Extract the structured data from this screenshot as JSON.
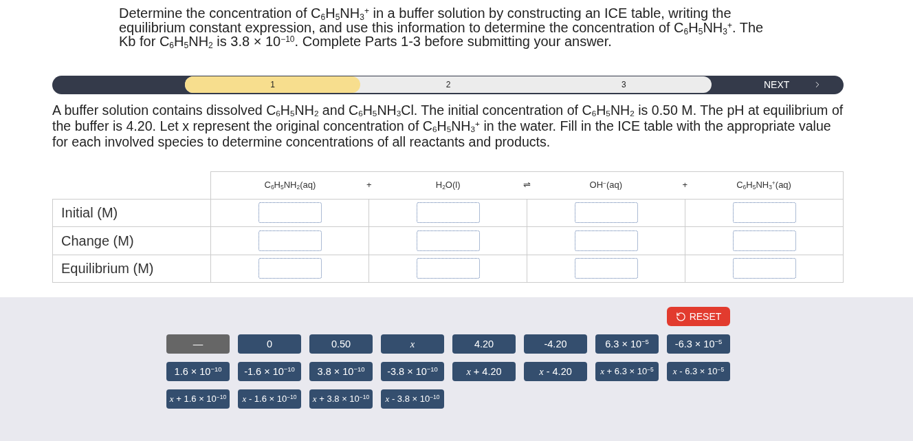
{
  "question": "Determine the concentration of C$_{6}$H$_{5}$NH$_{3}$$^{+}$ in a buffer solution by constructing an ICE table, writing the equilibrium constant expression, and use this information to determine the concentration of C$_{6}$H$_{5}$NH$_{3}$$^{+}$. The Kb for C$_{6}$H$_{5}$NH$_{2}$ is 3.8 × 10$^{−10}$. Complete Parts 1-3 before submitting your answer.",
  "progress": {
    "steps": [
      {
        "label": "1",
        "selected": true
      },
      {
        "label": "2",
        "selected": false
      },
      {
        "label": "3",
        "selected": false
      }
    ],
    "next_label": "NEXT"
  },
  "instructions": "A buffer solution contains dissolved C$_{6}$H$_{5}$NH$_{2}$ and C$_{6}$H$_{5}$NH$_{3}$Cl. The initial concentration of C$_{6}$H$_{5}$NH$_{2}$ is 0.50 M. The pH at equilibrium of the buffer is 4.20. Let x represent the original concentration of C$_{6}$H$_{5}$NH$_{3}$$^{+}$ in the water. Fill in the ICE table with the appropriate value for each involved species to determine concentrations of all reactants and products.",
  "ice_table": {
    "equation": [
      {
        "kind": "species",
        "text": "C$_{6}$H$_{5}$NH$_{2}$(aq)"
      },
      {
        "kind": "operator",
        "text": "+"
      },
      {
        "kind": "species",
        "text": "H$_{2}$O(l)"
      },
      {
        "kind": "operator",
        "text": "⇌"
      },
      {
        "kind": "species",
        "text": "OH$^{−}$(aq)"
      },
      {
        "kind": "operator",
        "text": "+"
      },
      {
        "kind": "species",
        "text": "C$_{6}$H$_{5}$NH$_{3}$$^{+}$(aq)"
      }
    ],
    "rows": [
      {
        "label": "Initial (M)"
      },
      {
        "label": "Change (M)"
      },
      {
        "label": "Equilibrium (M)"
      }
    ]
  },
  "answer_tray": {
    "reset_label": "RESET",
    "tiles": [
      {
        "kind": "blank",
        "text": "—"
      },
      {
        "kind": "value",
        "text": "0"
      },
      {
        "kind": "value",
        "text": "0.50"
      },
      {
        "kind": "value",
        "text": "*x*"
      },
      {
        "kind": "value",
        "text": "4.20"
      },
      {
        "kind": "value",
        "text": "-4.20"
      },
      {
        "kind": "value",
        "text": "6.3 × 10$^{−5}$"
      },
      {
        "kind": "value",
        "text": "-6.3 × 10$^{−5}$"
      },
      {
        "kind": "value",
        "text": "1.6 × 10$^{−10}$"
      },
      {
        "kind": "value",
        "text": "-1.6 × 10$^{−10}$"
      },
      {
        "kind": "value",
        "text": "3.8 × 10$^{−10}$"
      },
      {
        "kind": "value",
        "text": "-3.8 × 10$^{−10}$"
      },
      {
        "kind": "value",
        "text": "*x* + 4.20"
      },
      {
        "kind": "value",
        "text": "*x* - 4.20"
      },
      {
        "kind": "value",
        "text": "*x* + 6.3 × 10$^{−5}$"
      },
      {
        "kind": "value",
        "text": "*x* - 6.3 × 10$^{−5}$"
      },
      {
        "kind": "value",
        "text": "*x* + 1.6 × 10$^{−10}$"
      },
      {
        "kind": "value",
        "text": "*x* - 1.6 × 10$^{−10}$"
      },
      {
        "kind": "value",
        "text": "*x* + 3.8 × 10$^{−10}$"
      },
      {
        "kind": "value",
        "text": "*x* - 3.8 × 10$^{−10}$"
      }
    ]
  }
}
